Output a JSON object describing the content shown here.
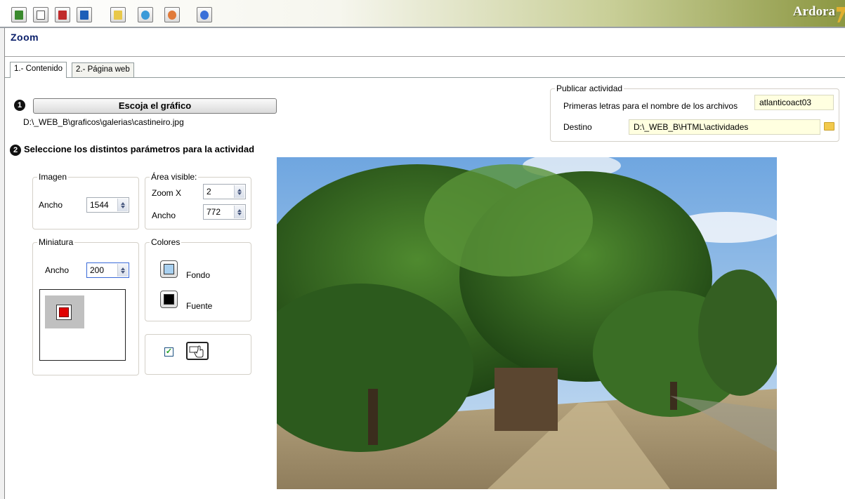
{
  "app": {
    "brand": "Ardora"
  },
  "toolbar": {
    "buttons": [
      {
        "name": "exit-icon",
        "color": "#3a8a2e"
      },
      {
        "name": "new-document-icon",
        "color": "#e6c24a"
      },
      {
        "name": "open-file-icon",
        "color": "#c02a2a"
      },
      {
        "name": "save-file-icon",
        "color": "#1d5fb8"
      },
      {
        "name": "notes-icon",
        "color": "#e8c84a"
      },
      {
        "name": "globe-icon",
        "color": "#3a9ad8"
      },
      {
        "name": "preview-eye-icon",
        "color": "#e07a3a"
      },
      {
        "name": "help-icon",
        "color": "#3a6fd8"
      }
    ]
  },
  "page": {
    "title": "Zoom"
  },
  "tabs": [
    {
      "label": "1.- Contenido",
      "active": true
    },
    {
      "label": "2.- Página web",
      "active": false
    }
  ],
  "step1": {
    "number": "1",
    "button_label": "Escoja el gráfico",
    "file_path": "D:\\_WEB_B\\graficos\\galerias\\castineiro.jpg"
  },
  "step2": {
    "number": "2",
    "label": "Seleccione los distintos parámetros para la actividad"
  },
  "imagen": {
    "title": "Imagen",
    "ancho_label": "Ancho",
    "ancho_value": "1544"
  },
  "area": {
    "title": "Área visible:",
    "zoom_label": "Zoom X",
    "zoom_value": "2",
    "ancho_label": "Ancho",
    "ancho_value": "772"
  },
  "miniatura": {
    "title": "Miniatura",
    "ancho_label": "Ancho",
    "ancho_value": "200"
  },
  "colores": {
    "title": "Colores",
    "fondo_label": "Fondo",
    "fondo_color": "#a8d0f0",
    "fuente_label": "Fuente",
    "fuente_color": "#000000"
  },
  "options": {
    "checkbox_checked": true,
    "icon": "hand-pointer-icon"
  },
  "publicar": {
    "title": "Publicar actividad",
    "prefix_label": "Primeras letras para el nombre de los archivos",
    "prefix_value": "atlanticoact03",
    "destino_label": "Destino",
    "destino_value": "D:\\_WEB_B\\HTML\\actividades"
  },
  "photo": {
    "subject": "photo-oak-trees"
  }
}
